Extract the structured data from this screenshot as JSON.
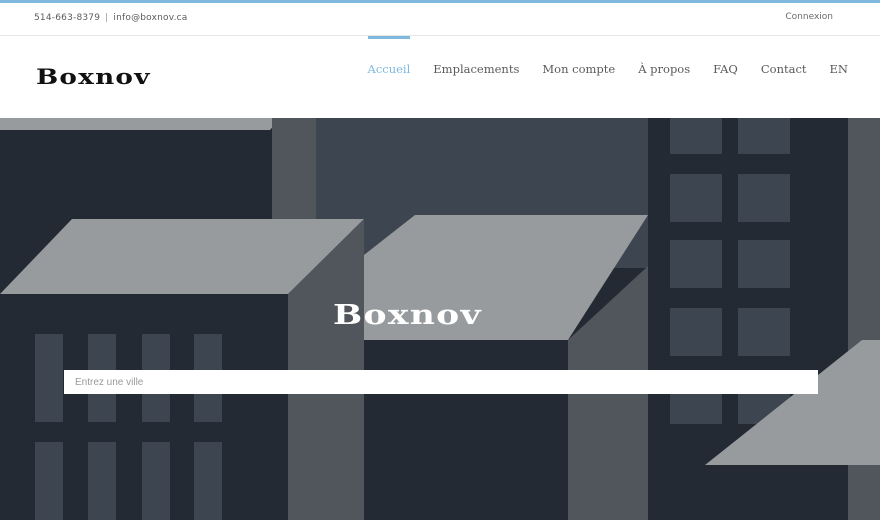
{
  "topbar": {
    "phone": "514-663-8379",
    "separator": "|",
    "email": "info@boxnov.ca",
    "login_label": "Connexion"
  },
  "header": {
    "logo_text": "Boxnov",
    "nav": [
      {
        "label": "Accueil",
        "active": true
      },
      {
        "label": "Emplacements",
        "active": false
      },
      {
        "label": "Mon compte",
        "active": false
      },
      {
        "label": "À propos",
        "active": false
      },
      {
        "label": "FAQ",
        "active": false
      },
      {
        "label": "Contact",
        "active": false
      },
      {
        "label": "EN",
        "active": false
      }
    ]
  },
  "hero": {
    "logo_text": "Boxnov",
    "search_placeholder": "Entrez une ville"
  },
  "colors": {
    "accent": "#7fb9df",
    "hero_dark": "#242a33",
    "hero_mid": "#3d4550",
    "hero_light": "#979b9e"
  }
}
